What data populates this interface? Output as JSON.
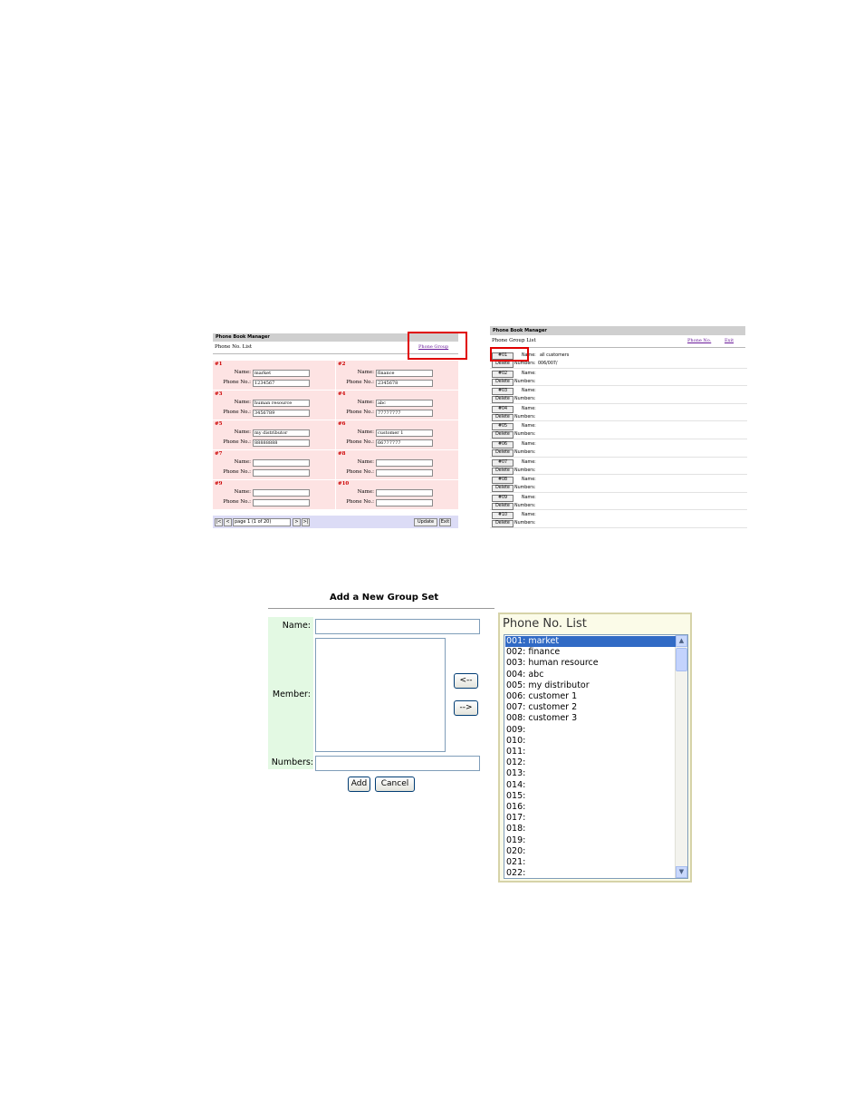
{
  "phone_list_panel": {
    "header": "Phone Book Manager",
    "subtitle": "Phone No. List",
    "group_link": "Phone Group",
    "name_label": "Name:",
    "phone_label": "Phone No.:",
    "entries": [
      {
        "num": "#1",
        "name": "market",
        "phone": "1234567"
      },
      {
        "num": "#2",
        "name": "finance",
        "phone": "2345678"
      },
      {
        "num": "#3",
        "name": "human resource",
        "phone": "3456789"
      },
      {
        "num": "#4",
        "name": "abc",
        "phone": "77777777"
      },
      {
        "num": "#5",
        "name": "my distributor",
        "phone": "88888888"
      },
      {
        "num": "#6",
        "name": "customer 1",
        "phone": "66777777"
      },
      {
        "num": "#7",
        "name": "",
        "phone": ""
      },
      {
        "num": "#8",
        "name": "",
        "phone": ""
      },
      {
        "num": "#9",
        "name": "",
        "phone": ""
      },
      {
        "num": "#10",
        "name": "",
        "phone": ""
      }
    ],
    "pager": {
      "first": "|<",
      "prev": "<",
      "page_value": "page 1 (1 of 20)",
      "next": ">",
      "last": ">|",
      "update": "Update",
      "exit": "Exit"
    }
  },
  "phone_group_panel": {
    "header": "Phone Book Manager",
    "subtitle": "Phone Group List",
    "phone_link": "Phone No.",
    "exit_link": "Exit",
    "name_label": "Name:",
    "numbers_label": "Numbers:",
    "delete_label": "Delete",
    "groups": [
      {
        "id": "#01",
        "name": "all customers",
        "numbers": "006/007/"
      },
      {
        "id": "#02",
        "name": "",
        "numbers": ""
      },
      {
        "id": "#03",
        "name": "",
        "numbers": ""
      },
      {
        "id": "#04",
        "name": "",
        "numbers": ""
      },
      {
        "id": "#05",
        "name": "",
        "numbers": ""
      },
      {
        "id": "#06",
        "name": "",
        "numbers": ""
      },
      {
        "id": "#07",
        "name": "",
        "numbers": ""
      },
      {
        "id": "#08",
        "name": "",
        "numbers": ""
      },
      {
        "id": "#09",
        "name": "",
        "numbers": ""
      },
      {
        "id": "#10",
        "name": "",
        "numbers": ""
      }
    ]
  },
  "add_group_form": {
    "title": "Add a New Group Set",
    "name_label": "Name:",
    "member_label": "Member:",
    "numbers_label": "Numbers:",
    "move_left": "<--",
    "move_right": "-->",
    "add": "Add",
    "cancel": "Cancel"
  },
  "phone_no_list": {
    "title": "Phone No. List",
    "selected_index": 0,
    "items": [
      "001: market",
      "002: finance",
      "003: human resource",
      "004: abc",
      "005: my distributor",
      "006: customer 1",
      "007: customer 2",
      "008: customer 3",
      "009:",
      "010:",
      "011:",
      "012:",
      "013:",
      "014:",
      "015:",
      "016:",
      "017:",
      "018:",
      "019:",
      "020:",
      "021:",
      "022:"
    ]
  },
  "colors": {
    "highlight_box": "#e00000",
    "phone_grid_bg": "#fde3e3",
    "entry_number": "#cc0000",
    "link": "#6a1b9a",
    "form_label_bg": "#e3f9e3",
    "list_selection": "#316ac5"
  }
}
